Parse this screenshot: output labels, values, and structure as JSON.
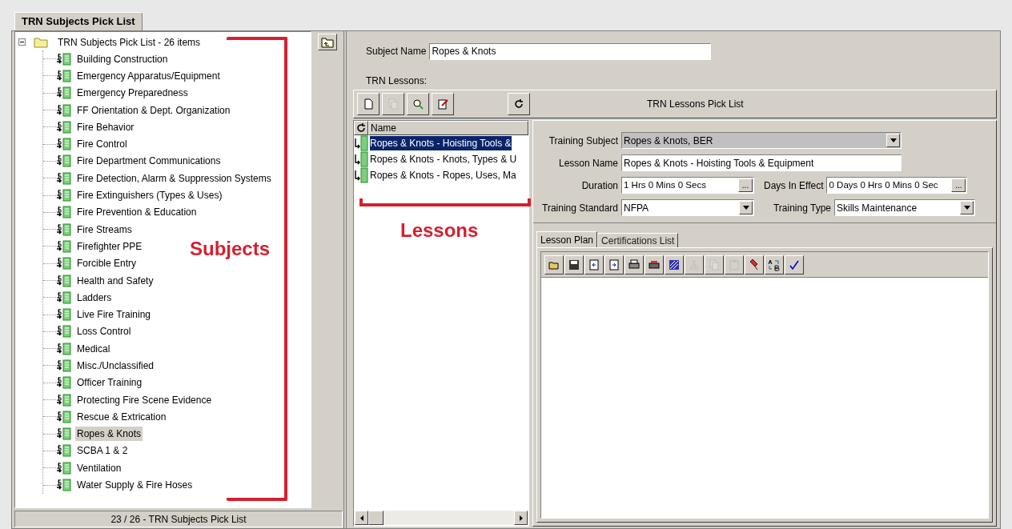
{
  "tab": {
    "label": "TRN Subjects Pick List",
    "selected": true
  },
  "tree": {
    "root": {
      "label": "TRN Subjects Pick List - 26 items",
      "expanded": true
    },
    "items": [
      {
        "label": "Building Construction",
        "selected": false
      },
      {
        "label": "Emergency Apparatus/Equipment",
        "selected": false
      },
      {
        "label": "Emergency Preparedness",
        "selected": false
      },
      {
        "label": "FF Orientation & Dept. Organization",
        "selected": false
      },
      {
        "label": "Fire Behavior",
        "selected": false
      },
      {
        "label": "Fire Control",
        "selected": false
      },
      {
        "label": "Fire Department Communications",
        "selected": false
      },
      {
        "label": "Fire Detection, Alarm & Suppression Systems",
        "selected": false
      },
      {
        "label": "Fire Extinguishers (Types & Uses)",
        "selected": false
      },
      {
        "label": "Fire Prevention & Education",
        "selected": false
      },
      {
        "label": "Fire Streams",
        "selected": false
      },
      {
        "label": "Firefighter PPE",
        "selected": false
      },
      {
        "label": "Forcible Entry",
        "selected": false
      },
      {
        "label": "Health and Safety",
        "selected": false
      },
      {
        "label": "Ladders",
        "selected": false
      },
      {
        "label": "Live Fire Training",
        "selected": false
      },
      {
        "label": "Loss Control",
        "selected": false
      },
      {
        "label": "Medical",
        "selected": false
      },
      {
        "label": "Misc./Unclassified",
        "selected": false
      },
      {
        "label": "Officer Training",
        "selected": false
      },
      {
        "label": "Protecting Fire Scene Evidence",
        "selected": false
      },
      {
        "label": "Rescue & Extrication",
        "selected": false
      },
      {
        "label": "Ropes & Knots",
        "selected": true
      },
      {
        "label": "SCBA 1 & 2",
        "selected": false
      },
      {
        "label": "Ventilation",
        "selected": false
      },
      {
        "label": "Water Supply & Fire Hoses",
        "selected": false
      }
    ]
  },
  "status_bar": "23 / 26 - TRN Subjects Pick List",
  "subject_name": {
    "label": "Subject Name",
    "value": "Ropes & Knots"
  },
  "lessons_label": "TRN Lessons:",
  "lessons_toolbar": {
    "title": "TRN Lessons Pick List",
    "buttons": [
      {
        "kind": "new",
        "disabled": false
      },
      {
        "kind": "copy",
        "disabled": true
      },
      {
        "kind": "find",
        "disabled": false
      },
      {
        "kind": "edit",
        "disabled": false
      },
      {
        "kind": "refresh",
        "disabled": false
      }
    ]
  },
  "lessons_list": {
    "column": "Name",
    "rows": [
      {
        "name": "Ropes & Knots - Hoisting Tools &",
        "selected": true
      },
      {
        "name": "Ropes & Knots - Knots, Types & U",
        "selected": false
      },
      {
        "name": "Ropes & Knots - Ropes, Uses, Ma",
        "selected": false
      }
    ]
  },
  "form": {
    "training_subject": {
      "label": "Training Subject",
      "value": "Ropes & Knots, BER",
      "disabled": true
    },
    "lesson_name": {
      "label": "Lesson Name",
      "value": "Ropes & Knots - Hoisting Tools & Equipment"
    },
    "duration": {
      "label": "Duration",
      "value": "1 Hrs 0 Mins 0 Secs",
      "button": "..."
    },
    "days_in_effect": {
      "label": "Days In Effect",
      "value": "0 Days 0 Hrs 0 Mins 0 Sec",
      "button": "..."
    },
    "training_standard": {
      "label": "Training Standard",
      "value": "NFPA"
    },
    "training_type": {
      "label": "Training Type",
      "value": "Skills Maintenance"
    }
  },
  "detail_tabs": [
    {
      "label": "Lesson Plan",
      "selected": true
    },
    {
      "label": "Certifications List",
      "selected": false
    }
  ],
  "editor_toolbar": [
    {
      "kind": "open",
      "disabled": false
    },
    {
      "kind": "save",
      "disabled": false
    },
    {
      "kind": "import",
      "disabled": false
    },
    {
      "kind": "export",
      "disabled": false
    },
    {
      "kind": "print",
      "disabled": false
    },
    {
      "kind": "print-setup",
      "disabled": false
    },
    {
      "kind": "format",
      "disabled": false
    },
    {
      "kind": "cut",
      "disabled": true
    },
    {
      "kind": "copy",
      "disabled": true
    },
    {
      "kind": "paste",
      "disabled": true
    },
    {
      "kind": "highlight",
      "disabled": false
    },
    {
      "kind": "replace",
      "disabled": false
    },
    {
      "kind": "spell",
      "disabled": false
    }
  ],
  "annotations": [
    {
      "kind": "subjects",
      "text": "Subjects"
    },
    {
      "kind": "lessons",
      "text": "Lessons"
    }
  ]
}
